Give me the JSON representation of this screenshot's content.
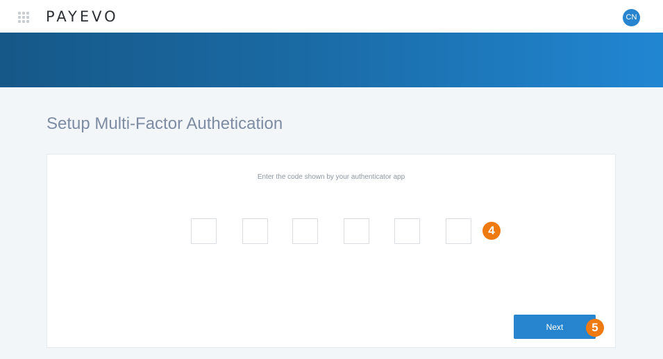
{
  "header": {
    "apps_icon": "grid-icon",
    "logo_text": "PAYEVO",
    "avatar_initials": "CN"
  },
  "page": {
    "title": "Setup Multi-Factor Authetication"
  },
  "mfa_form": {
    "instruction": "Enter the code shown by your authenticator app",
    "code_digits": [
      "",
      "",
      "",
      "",
      "",
      ""
    ],
    "next_label": "Next"
  },
  "annotations": {
    "step_4": "4",
    "step_5": "5"
  },
  "colors": {
    "accent": "#2784cf",
    "banner_start": "#165888",
    "banner_end": "#2186d2",
    "badge": "#ef7a12",
    "title": "#7d8ca3"
  }
}
